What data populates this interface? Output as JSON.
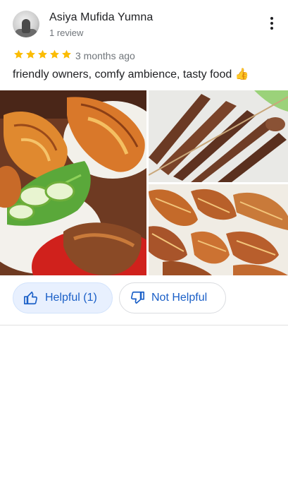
{
  "reviewer": {
    "name": "Asiya Mufida Yumna",
    "review_count": "1 review"
  },
  "rating": {
    "stars": 5,
    "max": 5,
    "color": "#fbbc04"
  },
  "time_ago": "3 months ago",
  "review_text": "friendly owners, comfy ambience, tasty food 👍",
  "photos": [
    {
      "icon": "grilled-lobster-photo"
    },
    {
      "icon": "meat-skewers-photo"
    },
    {
      "icon": "grilled-prawns-photo"
    }
  ],
  "actions": {
    "helpful_label": "Helpful (1)",
    "not_helpful_label": "Not Helpful"
  },
  "colors": {
    "accent": "#1a5fc7",
    "helpful_bg": "#e8f0fe"
  }
}
